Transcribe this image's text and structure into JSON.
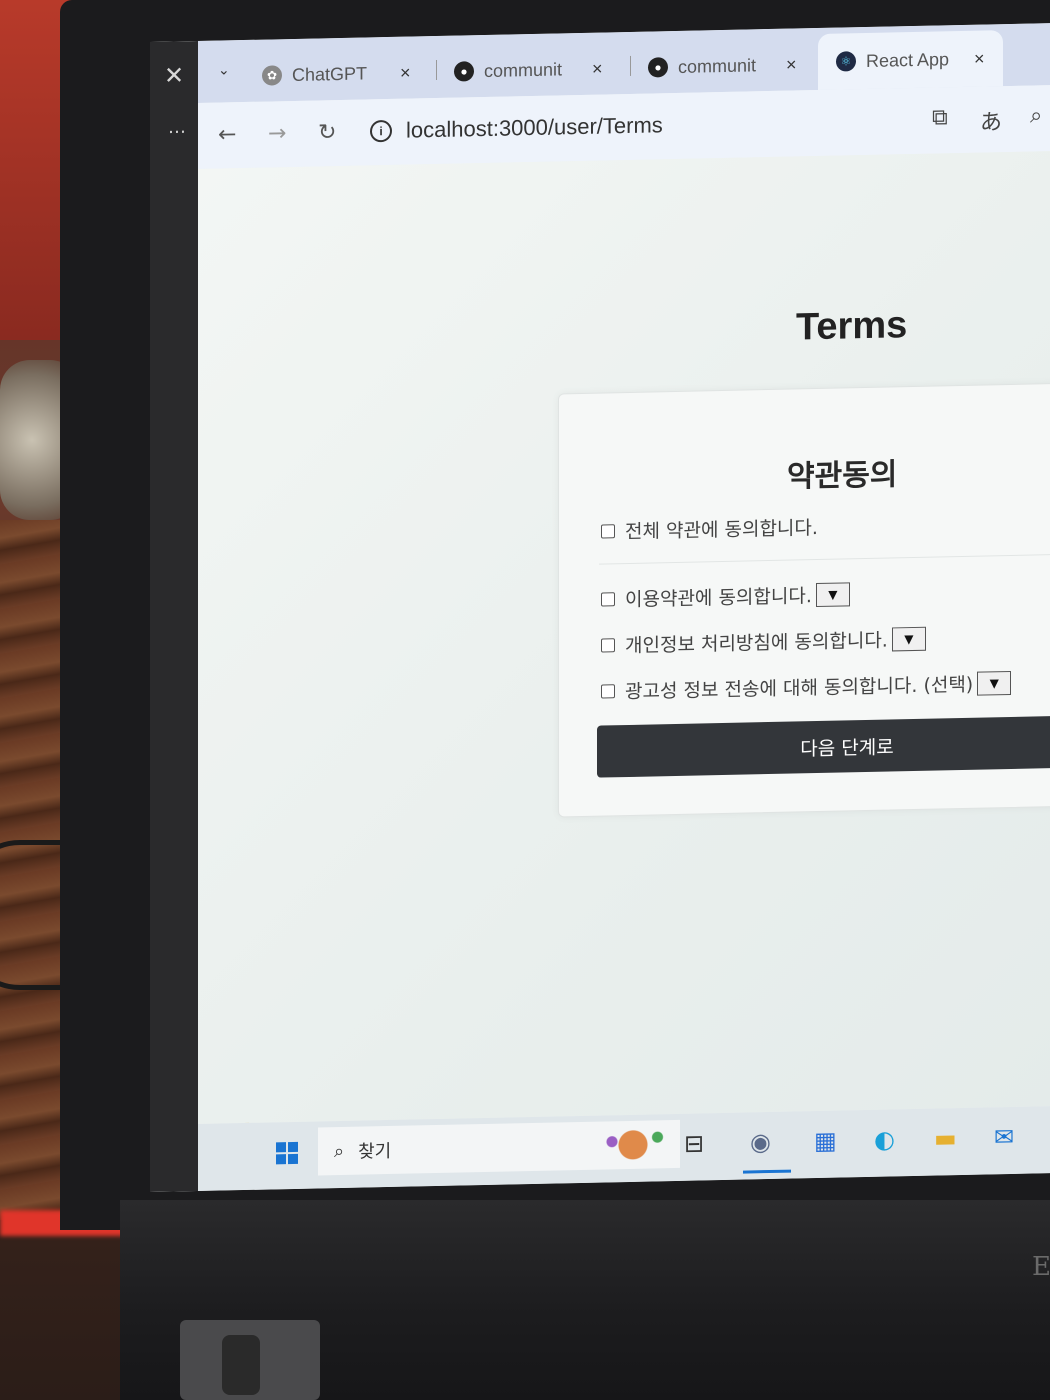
{
  "browser": {
    "tabs": [
      {
        "title": "ChatGPT",
        "icon": "chatgpt-icon",
        "active": false
      },
      {
        "title": "communit",
        "icon": "github-icon",
        "active": false
      },
      {
        "title": "communit",
        "icon": "github-icon",
        "active": false
      },
      {
        "title": "React App",
        "icon": "react-icon",
        "active": true
      }
    ],
    "tab_close_glyph": "×",
    "url": "localhost:3000/user/Terms"
  },
  "page": {
    "title": "Terms",
    "card": {
      "heading": "약관동의",
      "agree_all": "전체 약관에 동의합니다.",
      "items": [
        {
          "label": "이용약관에 동의합니다.",
          "expand": "▼"
        },
        {
          "label": "개인정보 처리방침에 동의합니다.",
          "expand": "▼"
        },
        {
          "label": "광고성 정보 전송에 대해 동의합니다. (선택)",
          "expand": "▼"
        }
      ],
      "next_button": "다음 단계로"
    }
  },
  "taskbar": {
    "search_label": "찾기"
  },
  "colors": {
    "button_bg": "#33363a",
    "tab_strip": "#d4dcee",
    "taskbar_accent": "#1a74d2"
  }
}
